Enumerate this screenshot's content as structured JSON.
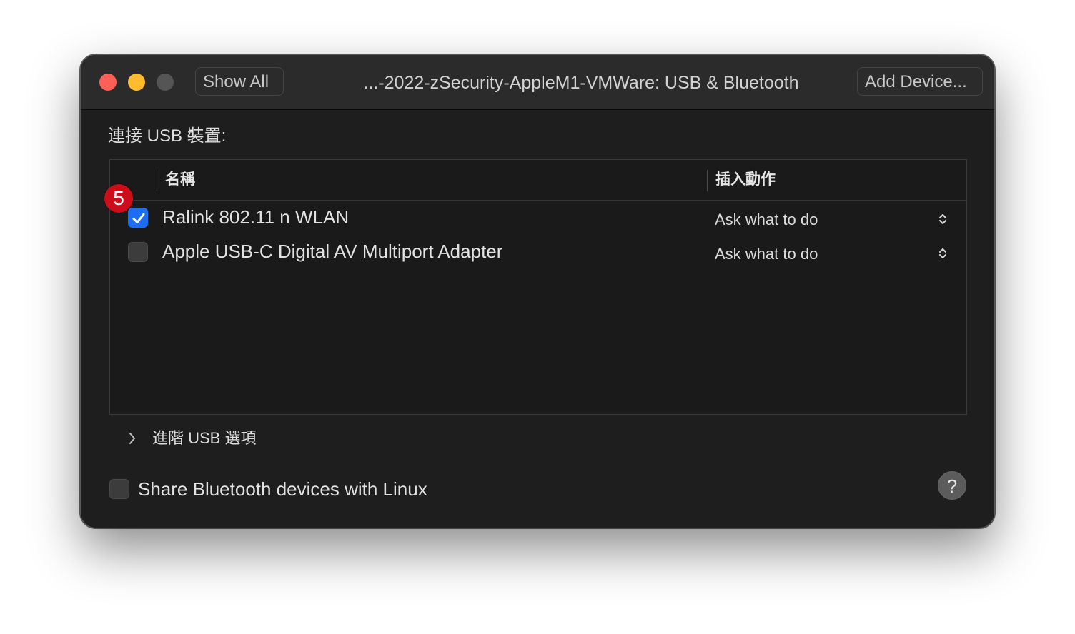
{
  "window": {
    "title": "...-2022-zSecurity-AppleM1-VMWare: USB & Bluetooth"
  },
  "toolbar": {
    "show_all_label": "Show All",
    "add_device_label": "Add Device..."
  },
  "usb": {
    "section_label": "連接 USB 裝置:",
    "columns": {
      "name": "名稱",
      "action": "插入動作"
    },
    "devices": [
      {
        "name": "Ralink 802.11 n WLAN",
        "checked": true,
        "action": "Ask what to do"
      },
      {
        "name": "Apple USB-C Digital AV Multiport Adapter",
        "checked": false,
        "action": "Ask what to do"
      }
    ],
    "advanced_label": "進階 USB 選項"
  },
  "bluetooth": {
    "share_label": "Share Bluetooth devices with Linux",
    "share_checked": false
  },
  "help": {
    "label": "?"
  },
  "annotation": {
    "step_number": "5",
    "color": "#cc0e1a"
  },
  "colors": {
    "accent": "#1b6ef2",
    "close": "#ff5f57",
    "minimize": "#febc2e",
    "zoom_disabled": "#555555"
  },
  "icons": [
    "close-icon",
    "minimize-icon",
    "zoom-icon",
    "checkmark-icon",
    "updown-arrows-icon",
    "chevron-right-icon",
    "help-icon"
  ]
}
